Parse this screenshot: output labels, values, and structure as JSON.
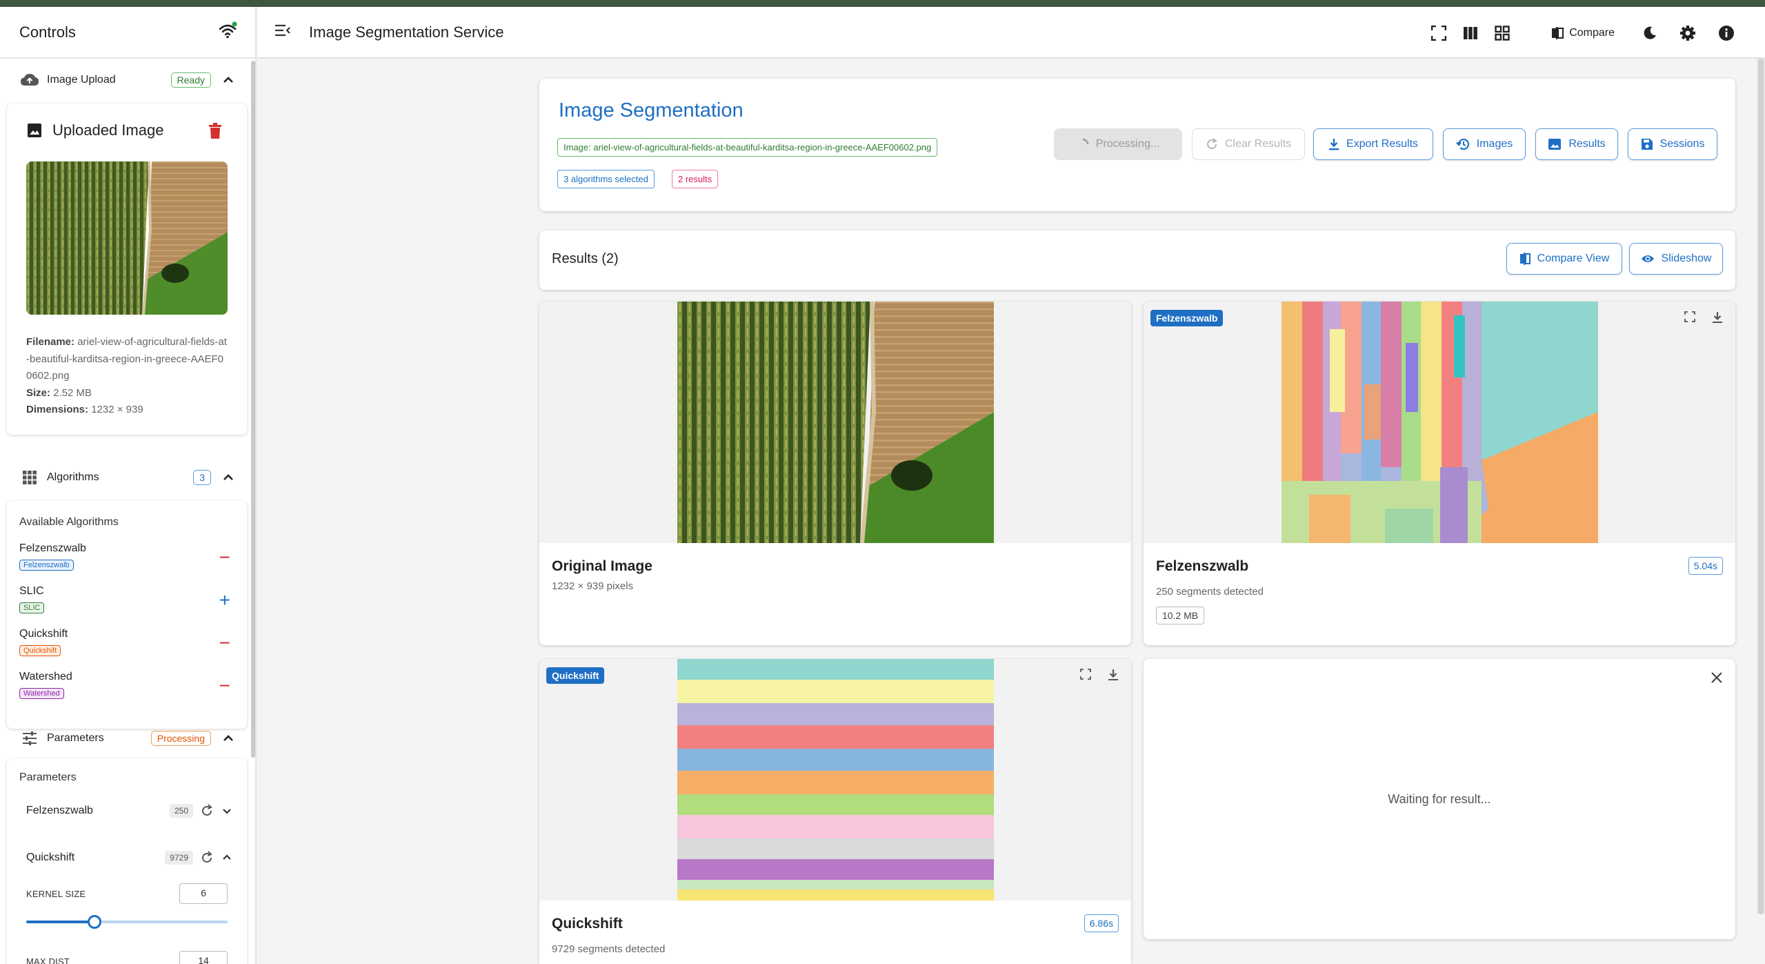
{
  "sidebar": {
    "title": "Controls",
    "upload": {
      "label": "Image Upload",
      "badge": "Ready",
      "card_title": "Uploaded Image",
      "filename_label": "Filename:",
      "filename": "ariel-view-of-agricultural-fields-at-beautiful-karditsa-region-in-greece-AAEF00602.png",
      "size_label": "Size:",
      "size": "2.52 MB",
      "dimensions_label": "Dimensions:",
      "dimensions": "1232 × 939"
    },
    "algorithms": {
      "label": "Algorithms",
      "count": "3",
      "header": "Available Algorithms",
      "items": [
        {
          "name": "Felzenszwalb",
          "tag": "Felzenszwalb",
          "action": "−"
        },
        {
          "name": "SLIC",
          "tag": "SLIC",
          "action": "+"
        },
        {
          "name": "Quickshift",
          "tag": "Quickshift",
          "action": "−"
        },
        {
          "name": "Watershed",
          "tag": "Watershed",
          "action": "−"
        }
      ]
    },
    "parameters": {
      "label": "Parameters",
      "badge": "Processing",
      "header": "Parameters",
      "groups": [
        {
          "name": "Felzenszwalb",
          "value": "250"
        },
        {
          "name": "Quickshift",
          "value": "9729"
        }
      ],
      "kernel_size_label": "KERNEL SIZE",
      "kernel_size": "6",
      "kernel_size_fraction": 0.34,
      "max_dist_label": "MAX DIST",
      "max_dist": "14"
    }
  },
  "topbar": {
    "title": "Image Segmentation Service",
    "compare_label": "Compare"
  },
  "hero": {
    "title": "Image Segmentation",
    "image_chip": "Image: ariel-view-of-agricultural-fields-at-beautiful-karditsa-region-in-greece-AAEF00602.png",
    "algorithms_chip": "3 algorithms selected",
    "results_chip": "2 results",
    "buttons": {
      "processing": "Processing...",
      "clear": "Clear Results",
      "export": "Export Results",
      "images": "Images",
      "results": "Results",
      "sessions": "Sessions"
    }
  },
  "results": {
    "title": "Results (2)",
    "compare_view": "Compare View",
    "slideshow": "Slideshow",
    "cards": [
      {
        "name": "Original Image",
        "sub": "1232 × 939 pixels"
      },
      {
        "chip": "Felzenszwalb",
        "name": "Felzenszwalb",
        "sub": "250 segments detected",
        "time": "5.04s",
        "size": "10.2 MB"
      },
      {
        "chip": "Quickshift",
        "name": "Quickshift",
        "sub": "9729 segments detected",
        "time": "6.86s"
      },
      {
        "waiting": "Waiting for result..."
      }
    ]
  },
  "colors": {
    "primary": "#1e6fc4",
    "danger": "#d32f2f",
    "topstrip": "#40573f"
  }
}
